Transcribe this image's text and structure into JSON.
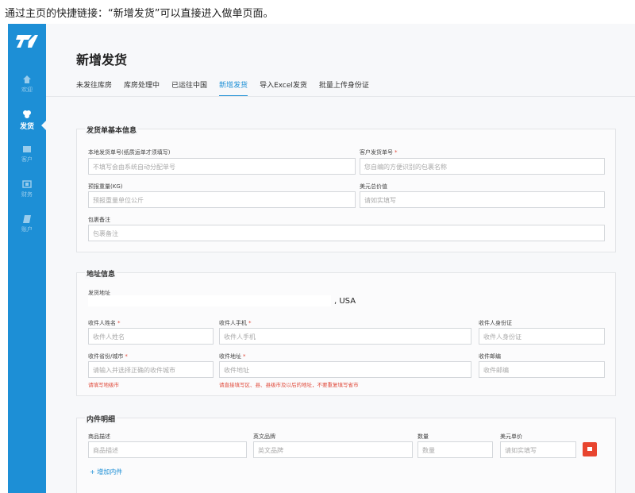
{
  "caption": "通过主页的快捷链接：“新增发货”可以直接进入做单页面。",
  "accent_color": "#1d8fd6",
  "sidebar": {
    "logo": "logo-icon",
    "items": [
      {
        "label": "欢迎",
        "icon": "home-icon",
        "active": false
      },
      {
        "label": "发货",
        "icon": "shipping-icon",
        "active": true
      },
      {
        "label": "客户",
        "icon": "users-icon",
        "active": false
      },
      {
        "label": "财务",
        "icon": "finance-icon",
        "active": false
      },
      {
        "label": "账户",
        "icon": "account-icon",
        "active": false
      }
    ]
  },
  "page": {
    "title": "新增发货",
    "tabs": [
      {
        "label": "未发往库房",
        "active": false
      },
      {
        "label": "库房处理中",
        "active": false
      },
      {
        "label": "已运往中国",
        "active": false
      },
      {
        "label": "新增发货",
        "active": true
      },
      {
        "label": "导入Excel发货",
        "active": false
      },
      {
        "label": "批量上传身份证",
        "active": false
      }
    ]
  },
  "basic": {
    "title": "发货单基本信息",
    "local_no_label": "本地发货单号(纸质运单才须填写)",
    "local_no_placeholder": "不填写会由系统自动分配单号",
    "customer_no_label": "客户发货单号",
    "customer_no_placeholder": "您自编的方便识别的包裹名称",
    "weight_label": "预报重量(KG)",
    "weight_placeholder": "预报重量单位公斤",
    "usd_label": "美元总价值",
    "usd_placeholder": "请如实填写",
    "note_label": "包裹备注",
    "note_placeholder": "包裹备注"
  },
  "address": {
    "title": "地址信息",
    "sender_label": "发货地址",
    "sender_value": ", USA",
    "name_label": "收件人姓名",
    "name_placeholder": "收件人姓名",
    "phone_label": "收件人手机",
    "phone_placeholder": "收件人手机",
    "id_label": "收件人身份证",
    "id_placeholder": "收件人身份证",
    "city_label": "收件省份/城市",
    "city_placeholder": "请输入并选择正确的收件城市",
    "city_error": "请填写地级市",
    "addr_label": "收件地址",
    "addr_placeholder": "收件地址",
    "addr_error": "请直接填写区、县、县级市及以后的地址，不要重复填写省市",
    "zip_label": "收件邮编",
    "zip_placeholder": "收件邮编"
  },
  "items": {
    "title": "内件明细",
    "desc_label": "商品描述",
    "desc_placeholder": "商品描述",
    "brand_label": "英文品牌",
    "brand_placeholder": "英文品牌",
    "qty_label": "数量",
    "qty_placeholder": "数量",
    "price_label": "美元单价",
    "price_placeholder": "请如实填写",
    "add_label": "+ 增加内件"
  }
}
